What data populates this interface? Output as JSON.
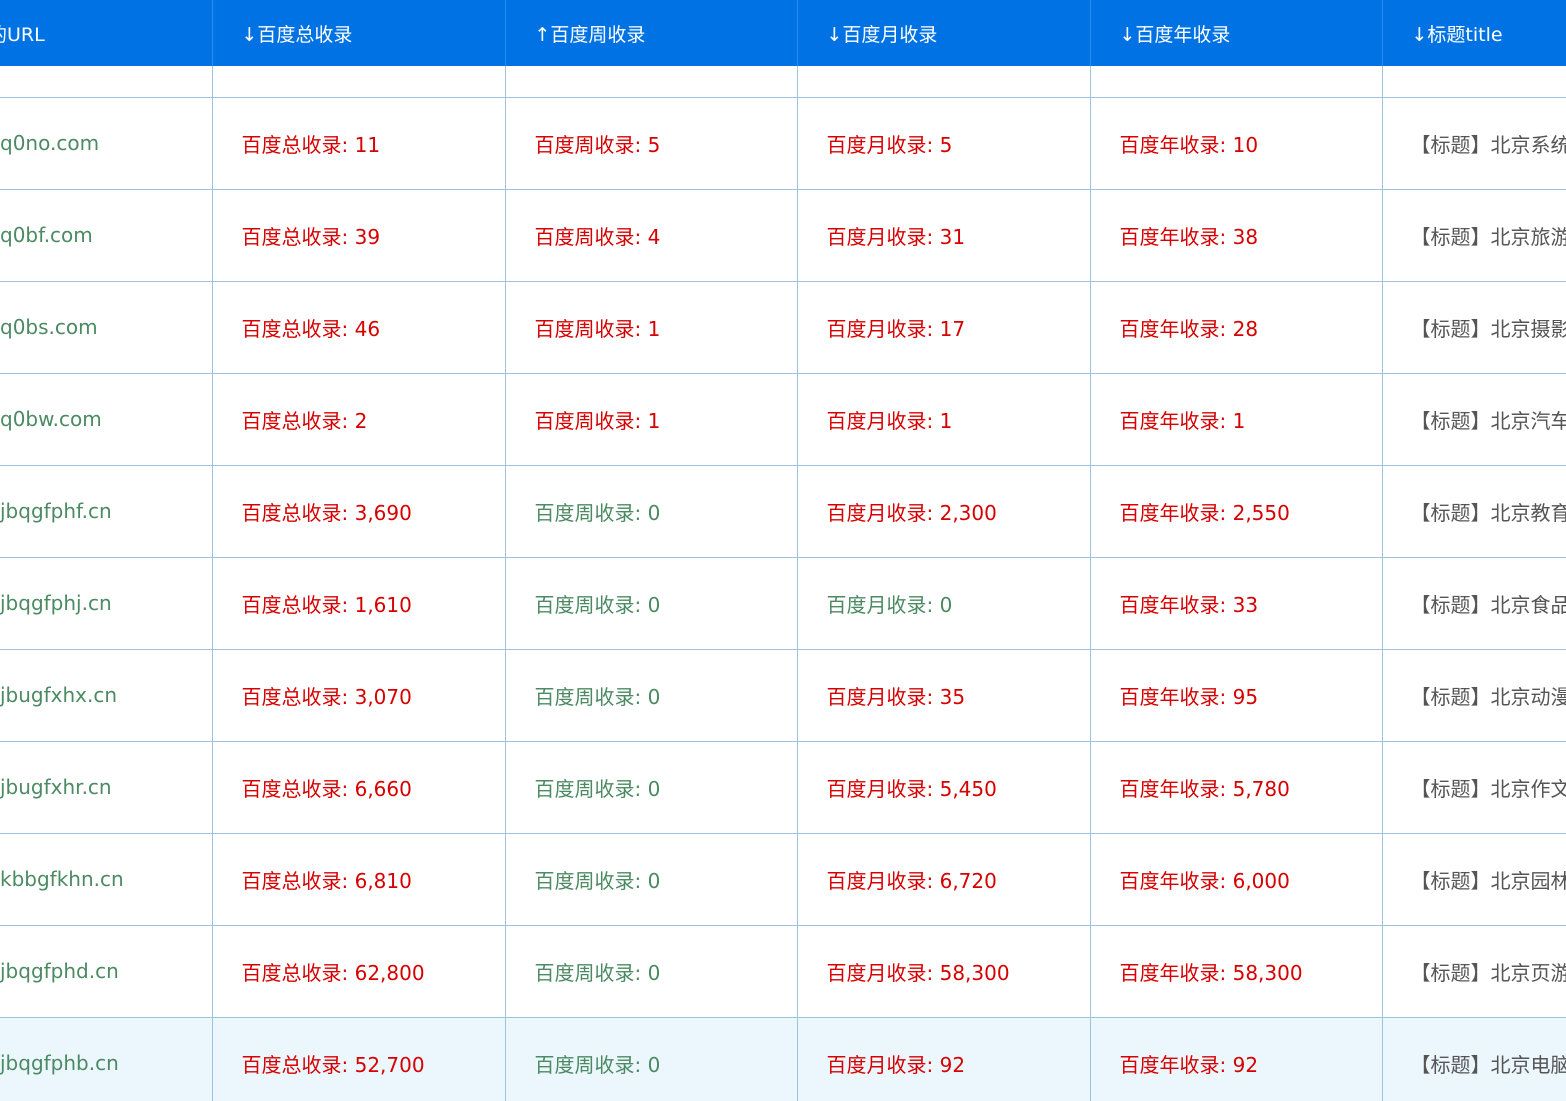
{
  "headers": {
    "url": "的URL",
    "total": "↓百度总收录",
    "week": "↑百度周收录",
    "month": "↓百度月收录",
    "year": "↓百度年收录",
    "title": "↓标题title"
  },
  "rows": [
    {
      "url": "q0no.com",
      "total": "百度总收录: 11",
      "week": "百度周收录: 5",
      "month": "百度月收录: 5",
      "year": "百度年收录: 10",
      "title": "【标题】北京系统"
    },
    {
      "url": "q0bf.com",
      "total": "百度总收录: 39",
      "week": "百度周收录: 4",
      "month": "百度月收录: 31",
      "year": "百度年收录: 38",
      "title": "【标题】北京旅游"
    },
    {
      "url": "q0bs.com",
      "total": "百度总收录: 46",
      "week": "百度周收录: 1",
      "month": "百度月收录: 17",
      "year": "百度年收录: 28",
      "title": "【标题】北京摄影"
    },
    {
      "url": "q0bw.com",
      "total": "百度总收录: 2",
      "week": "百度周收录: 1",
      "month": "百度月收录: 1",
      "year": "百度年收录: 1",
      "title": "【标题】北京汽车"
    },
    {
      "url": "jbqgfphf.cn",
      "total": "百度总收录: 3,690",
      "week": "百度周收录: 0",
      "month": "百度月收录: 2,300",
      "year": "百度年收录: 2,550",
      "title": "【标题】北京教育"
    },
    {
      "url": "jbqgfphj.cn",
      "total": "百度总收录: 1,610",
      "week": "百度周收录: 0",
      "month": "百度月收录: 0",
      "year": "百度年收录: 33",
      "title": "【标题】北京食品"
    },
    {
      "url": "jbugfxhx.cn",
      "total": "百度总收录: 3,070",
      "week": "百度周收录: 0",
      "month": "百度月收录: 35",
      "year": "百度年收录: 95",
      "title": "【标题】北京动漫"
    },
    {
      "url": "jbugfxhr.cn",
      "total": "百度总收录: 6,660",
      "week": "百度周收录: 0",
      "month": "百度月收录: 5,450",
      "year": "百度年收录: 5,780",
      "title": "【标题】北京作文"
    },
    {
      "url": "kbbgfkhn.cn",
      "total": "百度总收录: 6,810",
      "week": "百度周收录: 0",
      "month": "百度月收录: 6,720",
      "year": "百度年收录: 6,000",
      "title": "【标题】北京园林"
    },
    {
      "url": "jbqgfphd.cn",
      "total": "百度总收录: 62,800",
      "week": "百度周收录: 0",
      "month": "百度月收录: 58,300",
      "year": "百度年收录: 58,300",
      "title": "【标题】北京页游"
    },
    {
      "url": "jbqgfphb.cn",
      "total": "百度总收录: 52,700",
      "week": "百度周收录: 0",
      "month": "百度月收录: 92",
      "year": "百度年收录: 92",
      "title": "【标题】北京电脑"
    }
  ],
  "colors": {
    "header_bg": "#0072e3",
    "value_red": "#d60000",
    "value_zero_green": "#4b8a62",
    "url_green": "#4b8a62",
    "grid_border": "#9cc3e0",
    "hover_row_bg": "#ebf6fd"
  }
}
